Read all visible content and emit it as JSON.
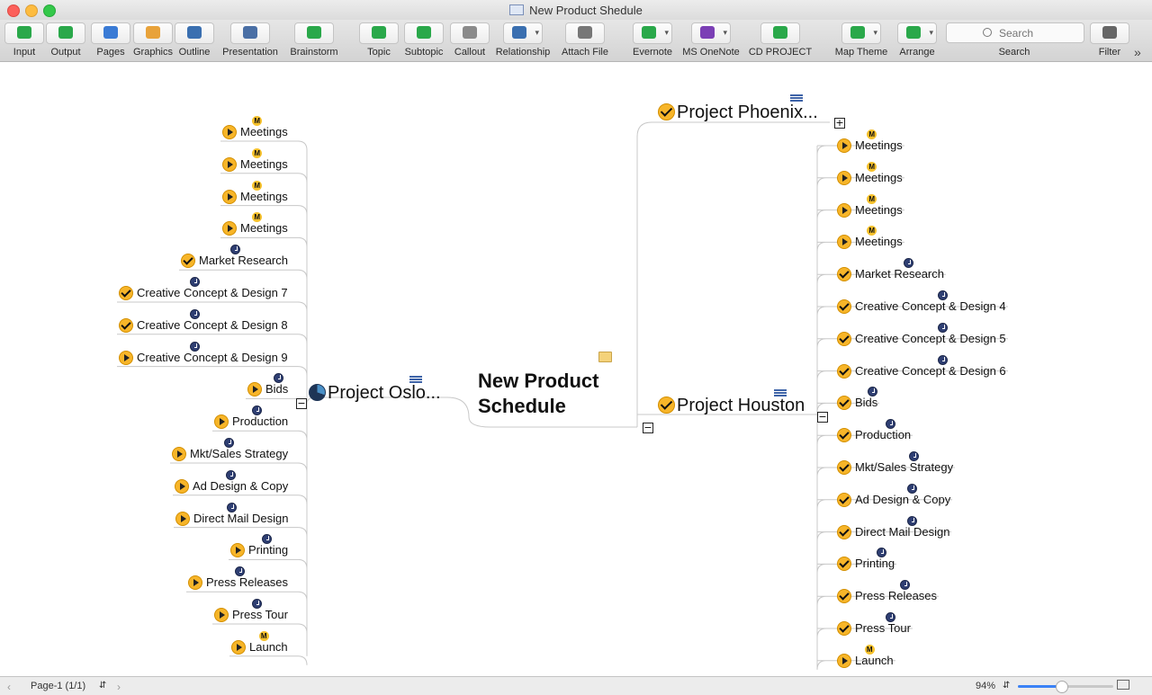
{
  "window": {
    "title": "New Product Shedule"
  },
  "toolbar": {
    "buttons": [
      {
        "label": "Input",
        "icon": "input-icon",
        "color": "#2aa84a"
      },
      {
        "label": "Output",
        "icon": "output-icon",
        "color": "#2aa84a"
      },
      {
        "label": "Pages",
        "icon": "pages-icon",
        "color": "#3a7bd5"
      },
      {
        "label": "Graphics",
        "icon": "graphics-icon",
        "color": "#e8a23a"
      },
      {
        "label": "Outline",
        "icon": "outline-icon",
        "color": "#3a6fb0"
      },
      {
        "label": "Presentation",
        "icon": "presentation-icon",
        "color": "#4a6fa5"
      },
      {
        "label": "Brainstorm",
        "icon": "brainstorm-icon",
        "color": "#2aa84a"
      },
      {
        "label": "Topic",
        "icon": "topic-icon",
        "color": "#2aa84a"
      },
      {
        "label": "Subtopic",
        "icon": "subtopic-icon",
        "color": "#2aa84a"
      },
      {
        "label": "Callout",
        "icon": "callout-icon",
        "color": "#8a8a8a"
      },
      {
        "label": "Relationship",
        "icon": "relationship-icon",
        "color": "#3a6fb0"
      },
      {
        "label": "Attach File",
        "icon": "paperclip-icon",
        "color": "#777777"
      },
      {
        "label": "Evernote",
        "icon": "evernote-icon",
        "color": "#2aa84a"
      },
      {
        "label": "MS OneNote",
        "icon": "onenote-icon",
        "color": "#7b3fb5"
      },
      {
        "label": "CD PROJECT",
        "icon": "cd-project-icon",
        "color": "#2aa84a"
      },
      {
        "label": "Map Theme",
        "icon": "map-theme-icon",
        "color": "#2aa84a"
      },
      {
        "label": "Arrange",
        "icon": "arrange-icon",
        "color": "#2aa84a"
      },
      {
        "label": "Filter",
        "icon": "filter-icon",
        "color": "#666666"
      }
    ],
    "search": {
      "placeholder": "Search",
      "label": "Search"
    }
  },
  "map": {
    "central": {
      "line1": "New Product",
      "line2": "Schedule"
    },
    "left_branch": {
      "title": "Project Oslo...",
      "children": [
        {
          "label": "Meetings",
          "status": "play",
          "marker": "M"
        },
        {
          "label": "Meetings",
          "status": "play",
          "marker": "M"
        },
        {
          "label": "Meetings",
          "status": "play",
          "marker": "M"
        },
        {
          "label": "Meetings",
          "status": "play",
          "marker": "M"
        },
        {
          "label": "Market Research",
          "status": "check",
          "marker": "clock"
        },
        {
          "label": "Creative Concept & Design 7",
          "status": "check",
          "marker": "clock"
        },
        {
          "label": "Creative Concept & Design 8",
          "status": "check",
          "marker": "clock"
        },
        {
          "label": "Creative Concept & Design 9",
          "status": "play",
          "marker": "clock"
        },
        {
          "label": "Bids",
          "status": "play",
          "marker": "clock"
        },
        {
          "label": "Production",
          "status": "play",
          "marker": "clock"
        },
        {
          "label": "Mkt/Sales Strategy",
          "status": "play",
          "marker": "clock"
        },
        {
          "label": "Ad Design & Copy",
          "status": "play",
          "marker": "clock"
        },
        {
          "label": "Direct Mail Design",
          "status": "play",
          "marker": "clock"
        },
        {
          "label": "Printing",
          "status": "play",
          "marker": "clock"
        },
        {
          "label": "Press Releases",
          "status": "play",
          "marker": "clock"
        },
        {
          "label": "Press Tour",
          "status": "play",
          "marker": "clock"
        },
        {
          "label": "Launch",
          "status": "play",
          "marker": "M"
        }
      ]
    },
    "right_top_branch": {
      "title": "Project Phoenix..."
    },
    "right_branch": {
      "title": "Project Houston",
      "children": [
        {
          "label": "Meetings",
          "status": "play",
          "marker": "M"
        },
        {
          "label": "Meetings",
          "status": "play",
          "marker": "M"
        },
        {
          "label": "Meetings",
          "status": "play",
          "marker": "M"
        },
        {
          "label": "Meetings",
          "status": "play",
          "marker": "M"
        },
        {
          "label": "Market Research",
          "status": "check",
          "marker": "clock"
        },
        {
          "label": "Creative Concept & Design 4",
          "status": "check",
          "marker": "clock"
        },
        {
          "label": "Creative Concept & Design 5",
          "status": "check",
          "marker": "clock"
        },
        {
          "label": "Creative Concept & Design 6",
          "status": "check",
          "marker": "clock"
        },
        {
          "label": "Bids",
          "status": "check",
          "marker": "clock"
        },
        {
          "label": "Production",
          "status": "check",
          "marker": "clock"
        },
        {
          "label": "Mkt/Sales Strategy",
          "status": "check",
          "marker": "clock"
        },
        {
          "label": "Ad Design & Copy",
          "status": "check",
          "marker": "clock"
        },
        {
          "label": "Direct Mail Design",
          "status": "check",
          "marker": "clock"
        },
        {
          "label": "Printing",
          "status": "check",
          "marker": "clock"
        },
        {
          "label": "Press Releases",
          "status": "check",
          "marker": "clock"
        },
        {
          "label": "Press Tour",
          "status": "check",
          "marker": "clock"
        },
        {
          "label": "Launch",
          "status": "play",
          "marker": "M"
        }
      ]
    }
  },
  "status": {
    "page": "Page-1 (1/1)",
    "zoom": "94%",
    "zoom_fraction": 0.45
  }
}
